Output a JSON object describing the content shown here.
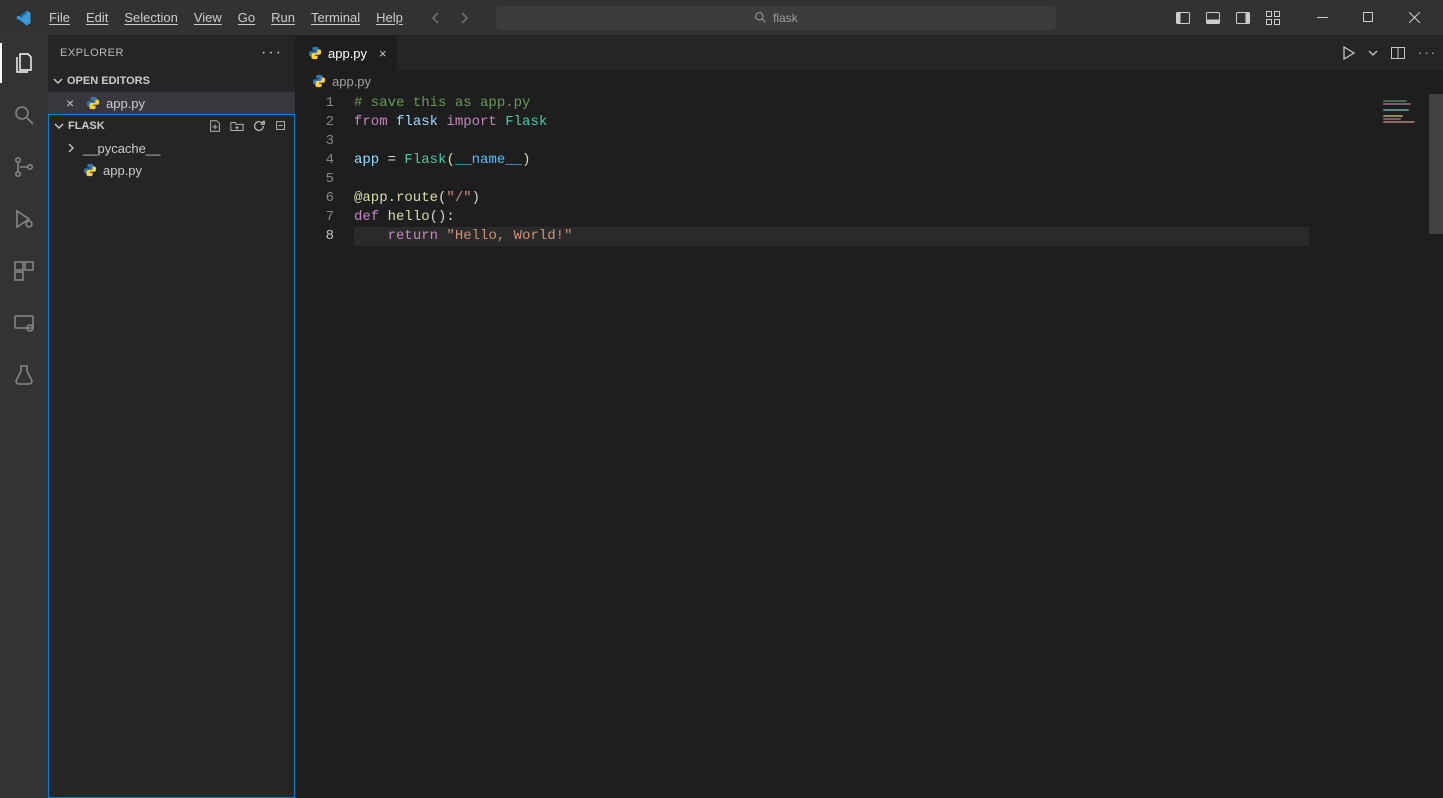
{
  "menu": {
    "file": "File",
    "edit": "Edit",
    "selection": "Selection",
    "view": "View",
    "go": "Go",
    "run": "Run",
    "terminal": "Terminal",
    "help": "Help"
  },
  "search": {
    "text": "flask"
  },
  "sidebar": {
    "title": "EXPLORER",
    "open_editors": "OPEN EDITORS",
    "open_editor_file": "app.py",
    "folder": "FLASK",
    "tree": {
      "pycache": "__pycache__",
      "app": "app.py"
    }
  },
  "tab": {
    "name": "app.py"
  },
  "breadcrumb": {
    "file": "app.py"
  },
  "code": {
    "l1": "# save this as app.py",
    "l2_from": "from",
    "l2_flask": " flask ",
    "l2_import": "import",
    "l2_Flask": " Flask",
    "l3": "",
    "l4_app": "app ",
    "l4_eq": "= ",
    "l4_Flask": "Flask",
    "l4_open": "(",
    "l4_name": "__name__",
    "l4_close": ")",
    "l5": "",
    "l6_at": "@app.route",
    "l6_open": "(",
    "l6_str": "\"/\"",
    "l6_close": ")",
    "l7_def": "def ",
    "l7_fn": "hello",
    "l7_rest": "():",
    "l8_indent": "    ",
    "l8_return": "return",
    "l8_sp": " ",
    "l8_str": "\"Hello, World!\""
  },
  "line_numbers": [
    "1",
    "2",
    "3",
    "4",
    "5",
    "6",
    "7",
    "8"
  ]
}
